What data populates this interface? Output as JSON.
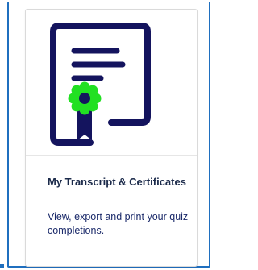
{
  "card": {
    "title": "My Transcript & Certificates",
    "description": "View, export and print your quiz completions.",
    "icon": "certificate-icon",
    "colors": {
      "icon_primary": "#14145e",
      "icon_badge": "#22e022",
      "focus_border": "#1f6fbf",
      "title_text": "#1b2a4a",
      "description_text": "#1b2a6a"
    }
  }
}
